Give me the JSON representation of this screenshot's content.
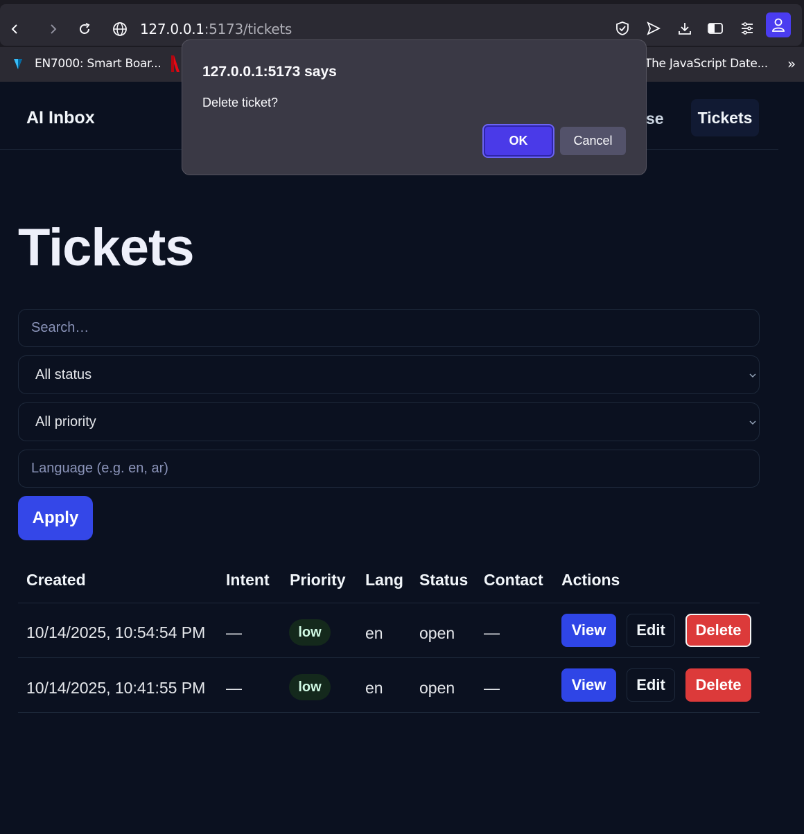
{
  "browser": {
    "url_host": "127.0.0.1",
    "url_path": ":5173/tickets",
    "bookmarks": [
      {
        "label": "EN7000: Smart Boar..."
      },
      {
        "label": "The JavaScript Date..."
      }
    ],
    "overflow_label": "»"
  },
  "app": {
    "logo": "AI Inbox",
    "nav_partial": "se",
    "nav_active": "Tickets"
  },
  "page": {
    "title": "Tickets"
  },
  "filters": {
    "search_placeholder": "Search…",
    "status_value": "All status",
    "priority_value": "All priority",
    "language_placeholder": "Language (e.g. en, ar)",
    "apply_label": "Apply"
  },
  "table": {
    "headers": [
      "Created",
      "Intent",
      "Priority",
      "Lang",
      "Status",
      "Contact",
      "Actions"
    ],
    "rows": [
      {
        "created": "10/14/2025, 10:54:54 PM",
        "intent": "—",
        "priority": "low",
        "lang": "en",
        "status": "open",
        "contact": "—"
      },
      {
        "created": "10/14/2025, 10:41:55 PM",
        "intent": "—",
        "priority": "low",
        "lang": "en",
        "status": "open",
        "contact": "—"
      }
    ],
    "view_label": "View",
    "edit_label": "Edit",
    "delete_label": "Delete"
  },
  "dialog": {
    "title": "127.0.0.1:5173 says",
    "message": "Delete ticket?",
    "ok_label": "OK",
    "cancel_label": "Cancel"
  },
  "colors": {
    "background": "#0b1120",
    "primary": "#3447e8",
    "danger": "#dc3a3a",
    "badge_bg": "#14291c"
  }
}
